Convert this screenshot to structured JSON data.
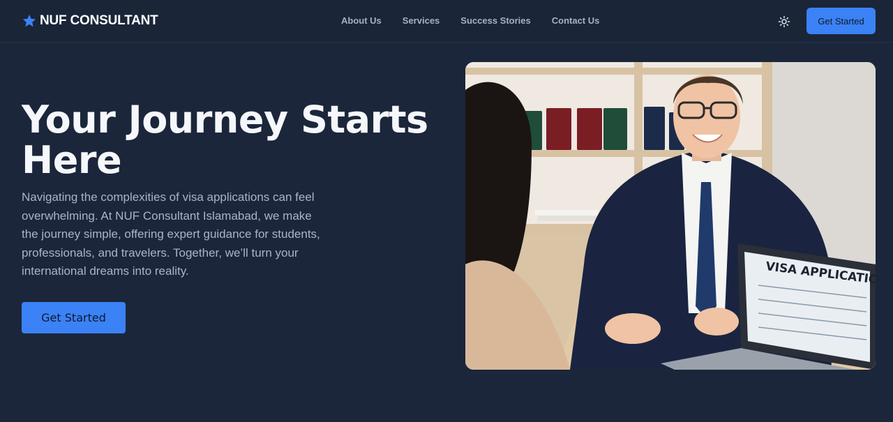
{
  "brand": {
    "name": "NUF CONSULTANT",
    "icon": "star-icon"
  },
  "nav": {
    "links": [
      "About Us",
      "Services",
      "Success Stories",
      "Contact Us"
    ],
    "theme_icon": "sun-icon",
    "cta_label": "Get Started"
  },
  "hero": {
    "title": "Your Journey Starts Here",
    "description": "Navigating the complexities of visa applications can feel overwhelming. At NUF Consultant Islamabad, we make the journey simple, offering expert guidance for students, professionals, and travelers. Together, we’ll turn your international dreams into reality.",
    "cta_label": "Get Started",
    "image": {
      "laptop_text": "VISA APPLICATION"
    }
  },
  "colors": {
    "background": "#1b263b",
    "navbar": "#1a2538",
    "accent": "#3b82f6",
    "heading": "#f5f7fa",
    "body_text": "#a9b4c6",
    "nav_text": "#a5b0c2"
  }
}
